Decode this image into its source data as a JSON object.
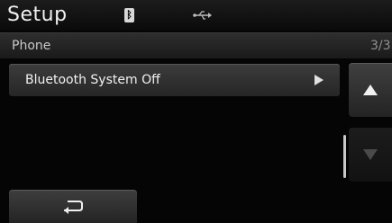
{
  "header": {
    "title": "Setup",
    "icons": [
      "bluetooth-icon",
      "usb-icon"
    ]
  },
  "sub_header": {
    "section": "Phone",
    "page": "3/3"
  },
  "list": {
    "items": [
      {
        "label": "Bluetooth System Off",
        "icon": "chevron-right-icon"
      }
    ]
  },
  "controls": {
    "scroll_up_icon": "arrow-up-icon",
    "scroll_down_icon": "arrow-down-icon",
    "scroll_down_enabled": false,
    "back_icon": "back-arrow-icon"
  }
}
